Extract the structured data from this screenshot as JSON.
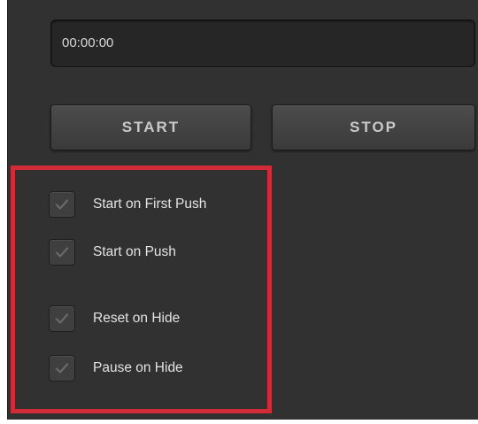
{
  "timer": {
    "value": "00:00:00"
  },
  "controls": {
    "start_label": "START",
    "stop_label": "STOP"
  },
  "options": [
    {
      "label": "Start on First Push",
      "checked": true
    },
    {
      "label": "Start on Push",
      "checked": true
    },
    {
      "label": "Reset on Hide",
      "checked": true
    },
    {
      "label": "Pause on Hide",
      "checked": true
    }
  ],
  "icons": {
    "checkbox_mark": "check-icon"
  },
  "colors": {
    "panel_bg": "#313131",
    "highlight": "#d12a39",
    "text": "#e3e3e3"
  }
}
